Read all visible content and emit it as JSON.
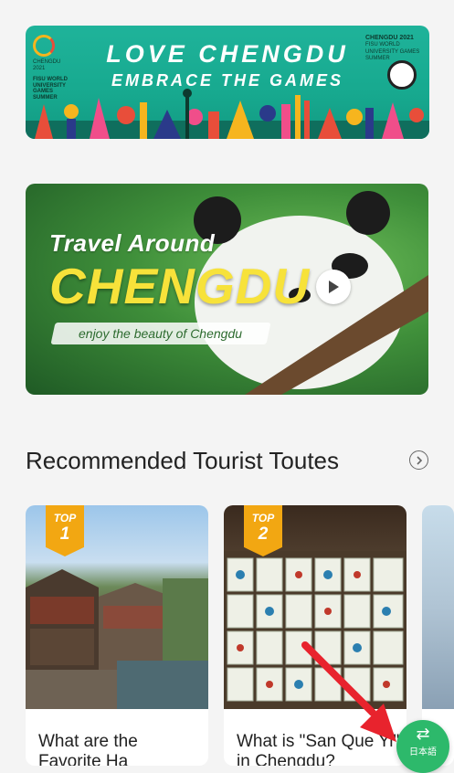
{
  "banner_games": {
    "title_line1": "LOVE CHENGDU",
    "title_line2": "EMBRACE THE GAMES",
    "logo_left_text": "FISU WORLD UNIVERSITY GAMES SUMMER",
    "logo_left_small": "CHENGDU 2021",
    "logo_right_text": "CHENGDU 2021",
    "logo_right_sub": "FISU WORLD UNIVERSITY GAMES SUMMER"
  },
  "banner_travel": {
    "line1": "Travel Around",
    "city": "CHENGDU",
    "tagline": "enjoy the beauty of Chengdu"
  },
  "recommended": {
    "title": "Recommended Tourist Toutes",
    "cards": [
      {
        "badge_top": "TOP",
        "rank": "1",
        "title": "What are the Favorite Ha"
      },
      {
        "badge_top": "TOP",
        "rank": "2",
        "title": "What is \"San Que Yi\" in Chengdu?"
      }
    ]
  },
  "language_button": {
    "label": "日本語"
  },
  "colors": {
    "banner_green": "#17a98f",
    "title_yellow": "#f7e23a",
    "badge_orange": "#f2a712",
    "fab_green": "#2db96b",
    "arrow_red": "#e8232d"
  }
}
